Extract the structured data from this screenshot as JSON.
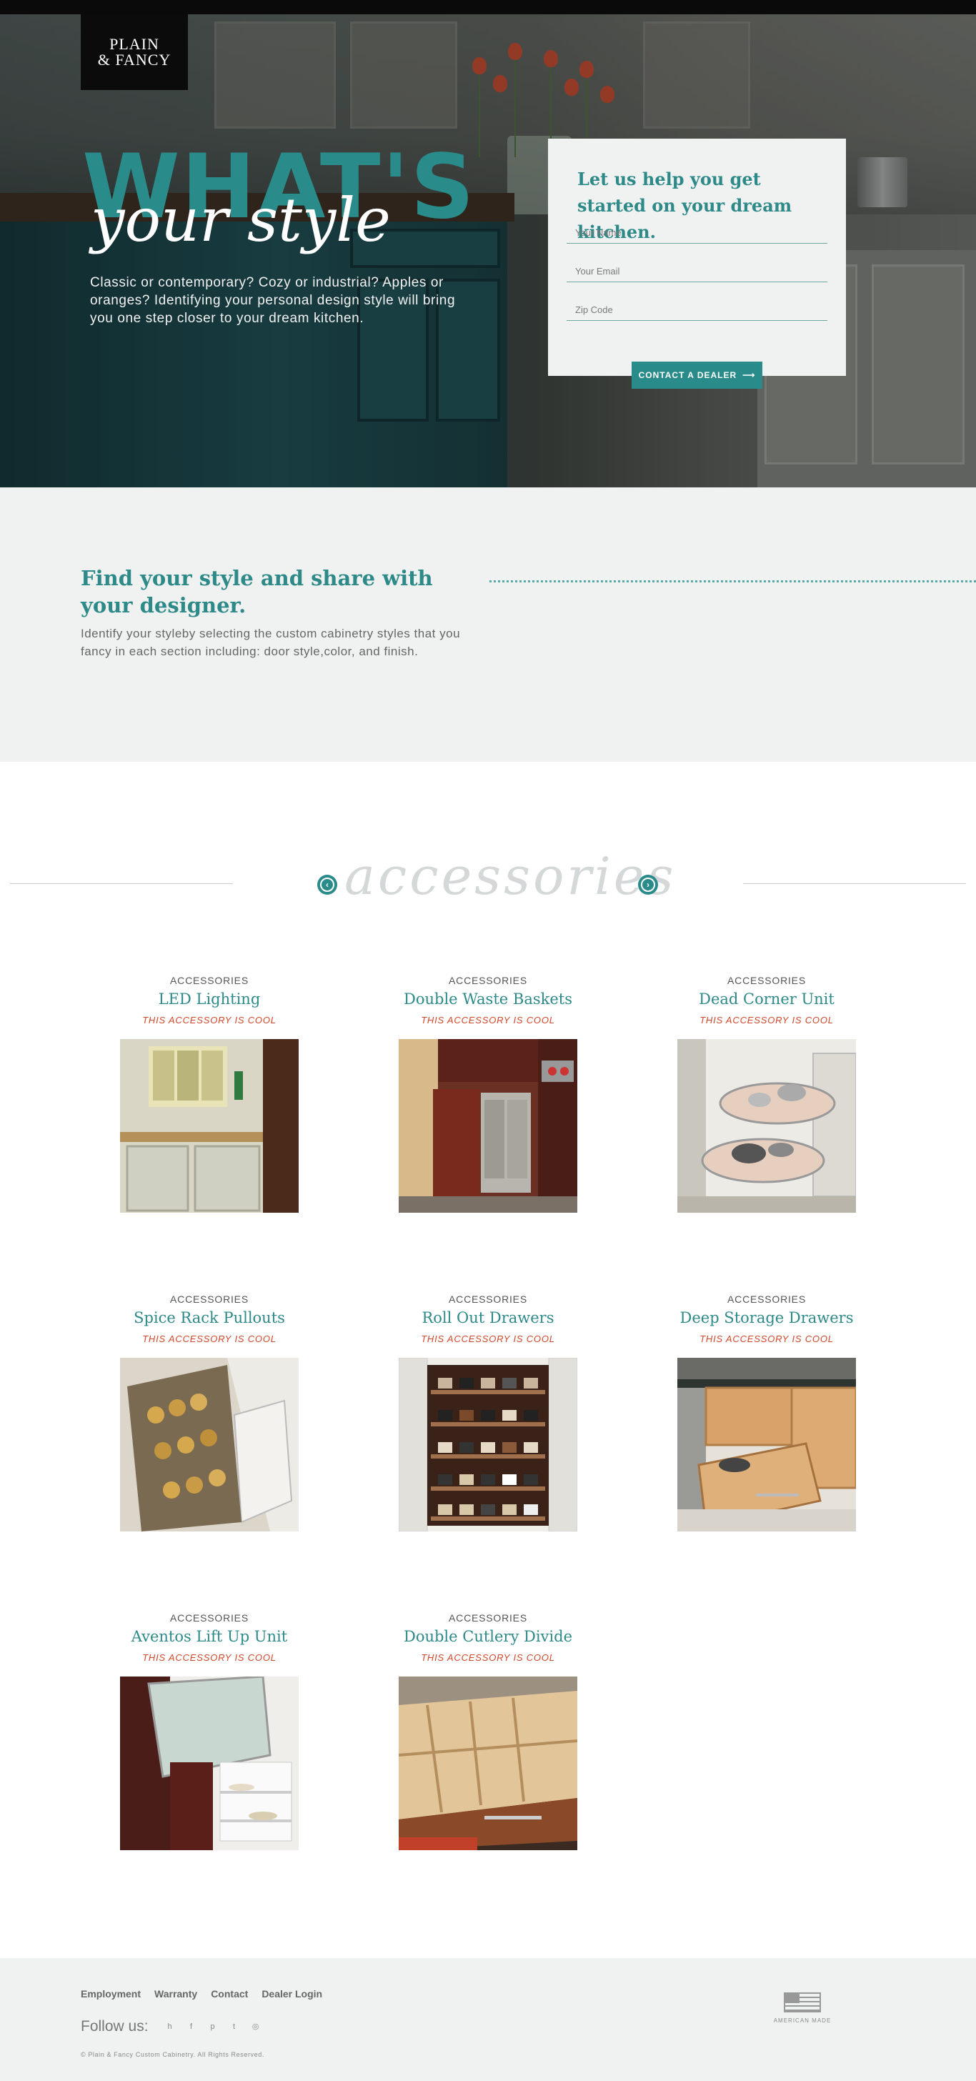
{
  "brand": {
    "logo_line1": "PLAIN",
    "logo_line2": "& FANCY"
  },
  "hero": {
    "title_big": "WHAT'S",
    "title_script": "your style",
    "description": "Classic or contemporary? Cozy or industrial? Apples or oranges? Identifying your personal design style will bring you one step closer to your dream kitchen."
  },
  "form": {
    "title": "Let us help you get started on your dream kitchen.",
    "name_placeholder": "Your Name",
    "email_placeholder": "Your Email",
    "zip_placeholder": "Zip Code",
    "button_label": "CONTACT A DEALER",
    "button_arrow": "⟶"
  },
  "find": {
    "title": "Find your style and share with your designer.",
    "description": "Identify your styleby selecting the custom cabinetry styles that you fancy in each section including: door style,color, and finish."
  },
  "accessories": {
    "heading": "accessories",
    "prev_icon": "arrow-left-circle-icon",
    "next_icon": "arrow-right-circle-icon",
    "items": [
      {
        "category": "ACCESSORIES",
        "name": "LED Lighting",
        "tag": "THIS ACCESSORY IS COOL"
      },
      {
        "category": "ACCESSORIES",
        "name": "Double Waste Baskets",
        "tag": "THIS ACCESSORY IS COOL"
      },
      {
        "category": "ACCESSORIES",
        "name": "Dead Corner Unit",
        "tag": "THIS ACCESSORY IS COOL"
      },
      {
        "category": "ACCESSORIES",
        "name": "Spice Rack Pullouts",
        "tag": "THIS ACCESSORY IS COOL"
      },
      {
        "category": "ACCESSORIES",
        "name": "Roll Out Drawers",
        "tag": "THIS ACCESSORY IS COOL"
      },
      {
        "category": "ACCESSORIES",
        "name": "Deep Storage Drawers",
        "tag": "THIS ACCESSORY IS COOL"
      },
      {
        "category": "ACCESSORIES",
        "name": "Aventos Lift Up Unit",
        "tag": "THIS ACCESSORY IS COOL"
      },
      {
        "category": "ACCESSORIES",
        "name": "Double Cutlery Divide",
        "tag": "THIS ACCESSORY IS COOL"
      }
    ]
  },
  "footer": {
    "links": [
      "Employment",
      "Warranty",
      "Contact",
      "Dealer Login"
    ],
    "follow_label": "Follow us:",
    "social_icons": [
      "houzz-icon",
      "facebook-icon",
      "pinterest-icon",
      "twitter-icon",
      "instagram-icon"
    ],
    "copyright": "© Plain & Fancy Custom Cabinetry. All Rights Reserved.",
    "american_made": "AMERICAN MADE"
  },
  "colors": {
    "accent": "#2a8c8a",
    "tag_red": "#d0472a",
    "panel_bg": "#f0f2f1"
  }
}
